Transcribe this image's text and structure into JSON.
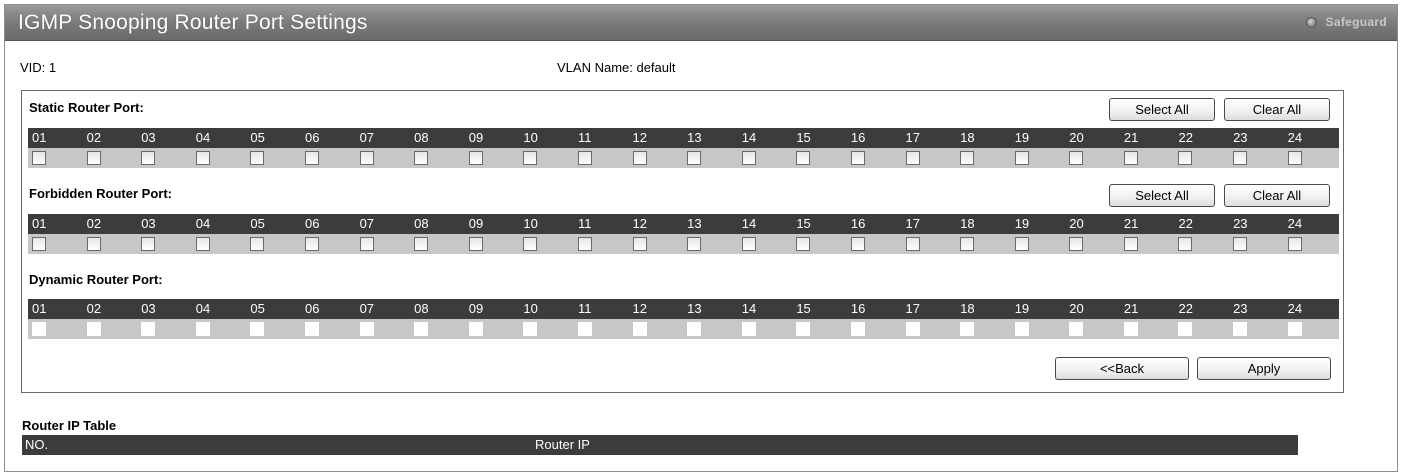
{
  "window": {
    "title": "IGMP Snooping Router Port Settings",
    "safeguard_label": "Safeguard"
  },
  "info": {
    "vid": "VID:  1",
    "vlan_name": "VLAN Name:  default"
  },
  "ports": [
    "01",
    "02",
    "03",
    "04",
    "05",
    "06",
    "07",
    "08",
    "09",
    "10",
    "11",
    "12",
    "13",
    "14",
    "15",
    "16",
    "17",
    "18",
    "19",
    "20",
    "21",
    "22",
    "23",
    "24"
  ],
  "static_section": {
    "title": "Static Router Port:",
    "select_all": "Select All",
    "clear_all": "Clear All"
  },
  "forbidden_section": {
    "title": "Forbidden Router Port:",
    "select_all": "Select All",
    "clear_all": "Clear All"
  },
  "dynamic_section": {
    "title": "Dynamic Router Port:"
  },
  "actions": {
    "back": "<<Back",
    "apply": "Apply"
  },
  "router_ip_table": {
    "title": "Router IP Table",
    "columns": [
      "NO.",
      "Router IP"
    ]
  }
}
